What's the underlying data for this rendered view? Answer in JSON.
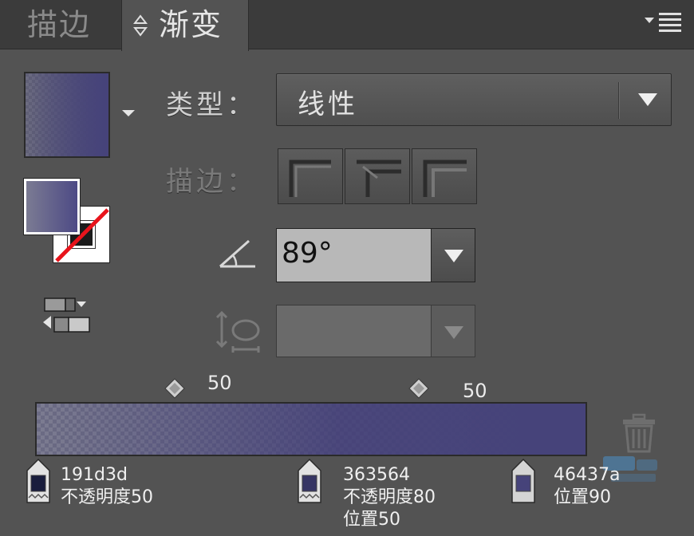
{
  "tabs": [
    {
      "label": "描边",
      "active": false
    },
    {
      "label": "渐变",
      "active": true
    }
  ],
  "type_label": "类型：",
  "type_value": "线性",
  "stroke_label": "描边：",
  "angle_value": "89°",
  "midpoints": [
    {
      "label": "50"
    },
    {
      "label": "50"
    }
  ],
  "stops": [
    {
      "color": "#191d3d",
      "line1": "191d3d",
      "line2": "不透明度50",
      "line3": ""
    },
    {
      "color": "#363564",
      "line1": "363564",
      "line2": "不透明度80",
      "line3": "位置50"
    },
    {
      "color": "#46437a",
      "line1": "46437a",
      "line2": "位置90",
      "line3": ""
    }
  ],
  "colors": {
    "panel_bg": "#535353",
    "tab_bar": "#3b3b3b",
    "gradient_end": "#46437a",
    "no_stroke": "#e8141c"
  },
  "icons": [
    "panel-menu-icon",
    "reverse-gradient-icon",
    "angle-icon",
    "aspect-ratio-icon",
    "trash-icon"
  ]
}
